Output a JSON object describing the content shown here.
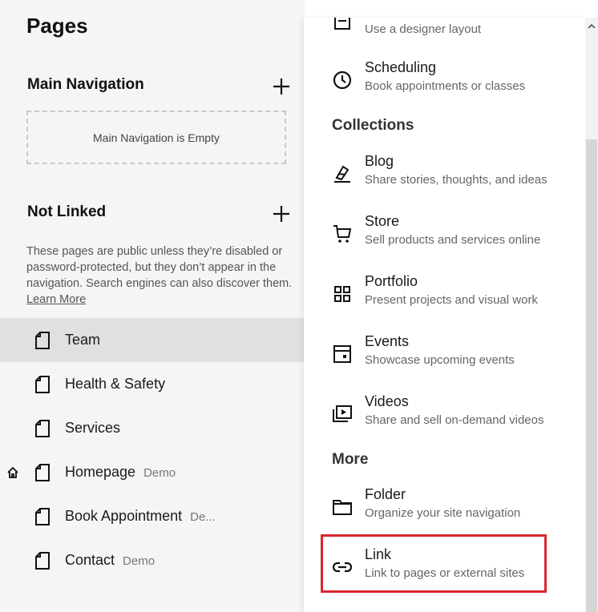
{
  "pages_panel": {
    "title": "Pages",
    "main_navigation": {
      "title": "Main Navigation",
      "empty_text": "Main Navigation is Empty"
    },
    "not_linked": {
      "title": "Not Linked",
      "description": "These pages are public unless they’re disabled or password-protected, but they don’t appear in the navigation. Search engines can also discover them.",
      "learn_more": "Learn More"
    },
    "pages": [
      {
        "label": "Team",
        "badge": "",
        "selected": true,
        "home": false
      },
      {
        "label": "Health & Safety",
        "badge": "",
        "selected": false,
        "home": false
      },
      {
        "label": "Services",
        "badge": "",
        "selected": false,
        "home": false
      },
      {
        "label": "Homepage",
        "badge": "Demo",
        "selected": false,
        "home": true
      },
      {
        "label": "Book Appointment",
        "badge": "De...",
        "selected": false,
        "home": false
      },
      {
        "label": "Contact",
        "badge": "Demo",
        "selected": false,
        "home": false
      }
    ]
  },
  "add_menu": {
    "top_item": {
      "subtitle": "Use a designer layout",
      "icon": "layout-icon"
    },
    "scheduling": {
      "title": "Scheduling",
      "subtitle": "Book appointments or classes",
      "icon": "clock-icon"
    },
    "collections_label": "Collections",
    "collections": [
      {
        "title": "Blog",
        "subtitle": "Share stories, thoughts, and ideas",
        "icon": "pen-icon"
      },
      {
        "title": "Store",
        "subtitle": "Sell products and services online",
        "icon": "cart-icon"
      },
      {
        "title": "Portfolio",
        "subtitle": "Present projects and visual work",
        "icon": "grid-icon"
      },
      {
        "title": "Events",
        "subtitle": "Showcase upcoming events",
        "icon": "calendar-icon"
      },
      {
        "title": "Videos",
        "subtitle": "Share and sell on-demand videos",
        "icon": "video-icon"
      }
    ],
    "more_label": "More",
    "more": [
      {
        "title": "Folder",
        "subtitle": "Organize your site navigation",
        "icon": "folder-icon"
      },
      {
        "title": "Link",
        "subtitle": "Link to pages or external sites",
        "icon": "link-icon",
        "highlighted": true
      }
    ]
  },
  "colors": {
    "highlight": "#d9262c",
    "selected_row": "#e0e0e0",
    "panel_bg": "#f5f5f5"
  }
}
